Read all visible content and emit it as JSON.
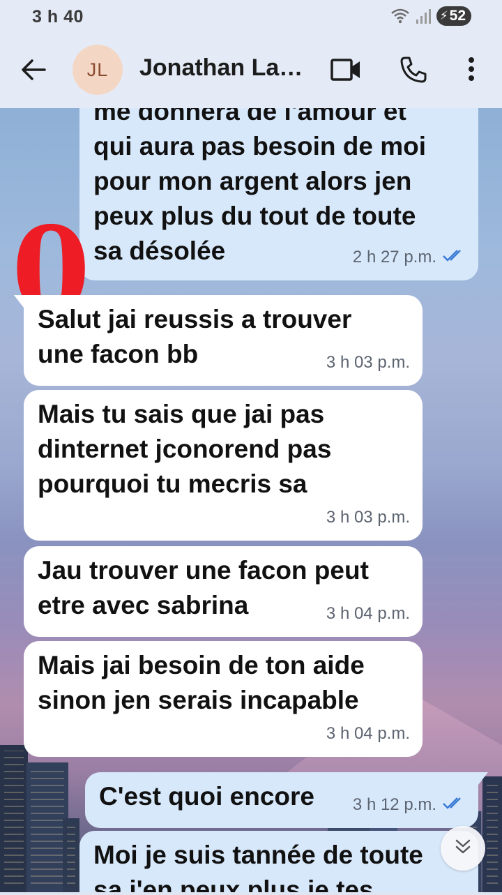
{
  "status_bar": {
    "time": "3 h 40",
    "battery": "52"
  },
  "header": {
    "avatar_initials": "JL",
    "contact_name": "Jonathan Lapointe",
    "icons": [
      "back-arrow-icon",
      "video-call-icon",
      "phone-icon",
      "more-vertical-icon"
    ]
  },
  "overlay": {
    "red_text": "0"
  },
  "messages": [
    {
      "direction": "outgoing",
      "text": "me donnera de l'amour et\nqui aura pas besoin de moi\npour mon argent alors jen\npeux plus du tout de toute\nsa désolée",
      "time": "2 h 27 p.m.",
      "read": true
    },
    {
      "direction": "incoming",
      "text": "Salut jai reussis a trouver\nune facon bb",
      "time": "3 h 03 p.m."
    },
    {
      "direction": "incoming",
      "text": "Mais tu sais que jai pas\ndinternet jconorend pas\npourquoi tu mecris sa",
      "time": "3 h 03 p.m."
    },
    {
      "direction": "incoming",
      "text": "Jau trouver une facon peut\netre avec sabrina",
      "time": "3 h 04 p.m."
    },
    {
      "direction": "incoming",
      "text": "Mais jai besoin de ton aide\nsinon jen serais incapable",
      "time": "3 h 04 p.m."
    },
    {
      "direction": "outgoing",
      "text": "C'est quoi encore",
      "time": "3 h 12 p.m.",
      "read": true
    },
    {
      "direction": "outgoing",
      "text": "Moi je suis tannée de toute\nsa j'en peux plus je tes",
      "time": ""
    }
  ],
  "colors": {
    "outgoing_bubble": "#d8e8fb",
    "incoming_bubble": "#ffffff",
    "read_check": "#3a7bd5",
    "red_overlay": "#ee1c24"
  }
}
